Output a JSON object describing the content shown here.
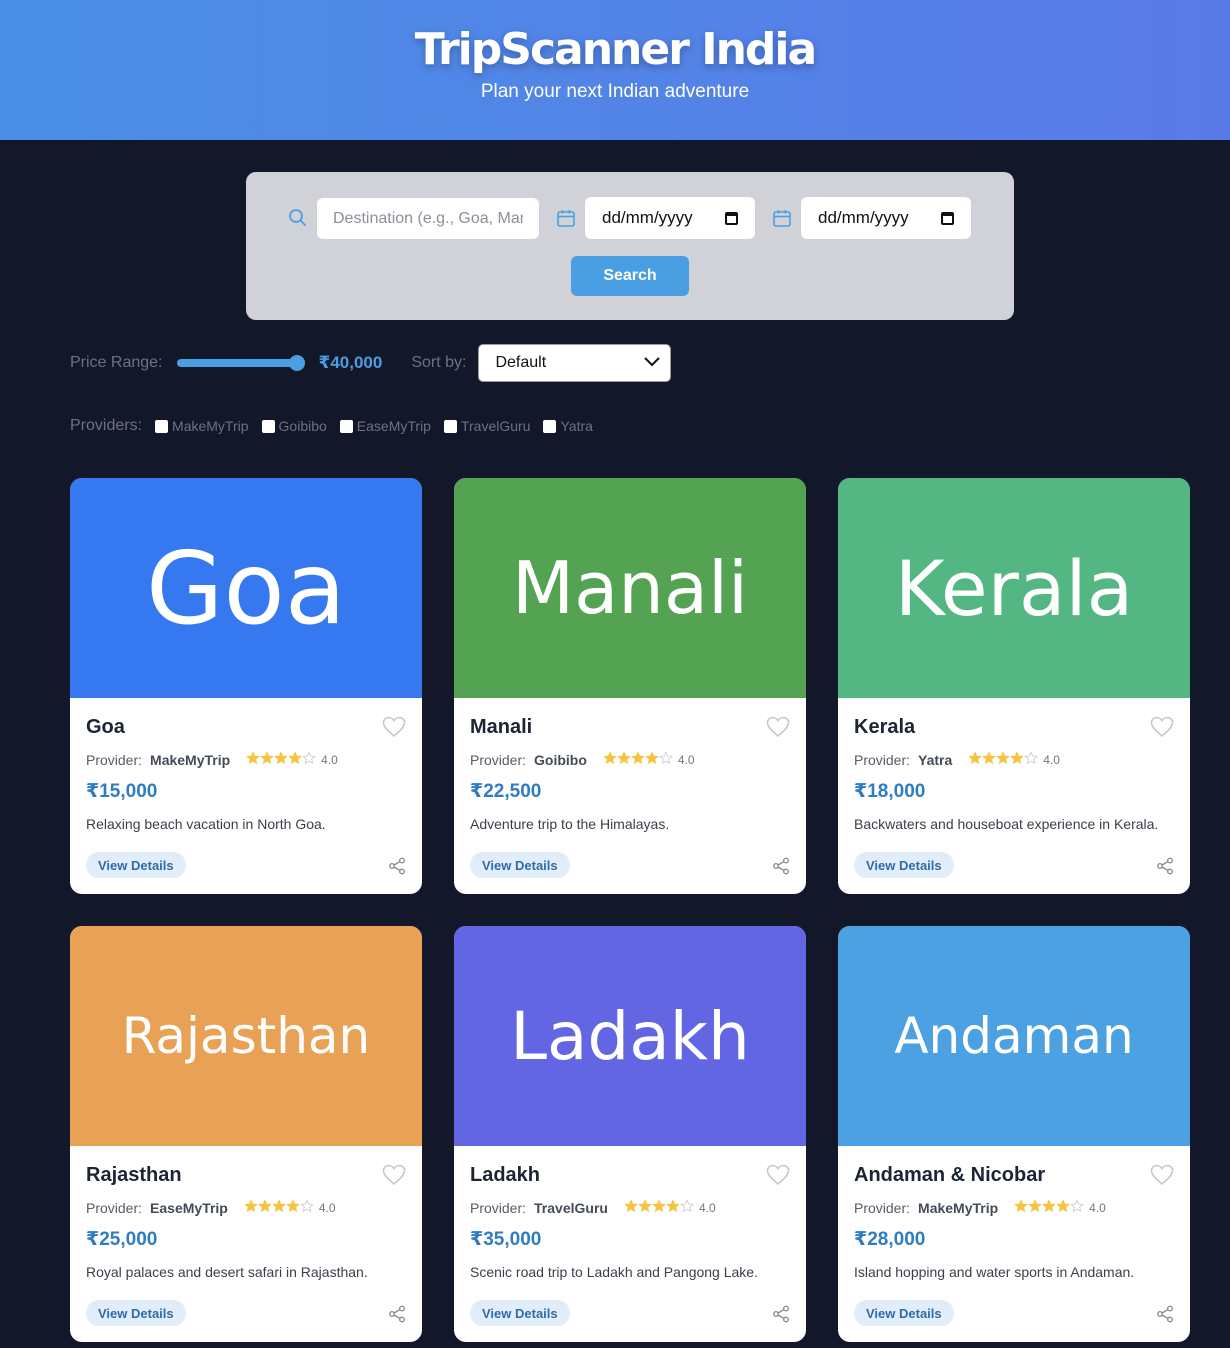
{
  "header": {
    "title": "TripScanner India",
    "subtitle": "Plan your next Indian adventure"
  },
  "search": {
    "destination_placeholder": "Destination (e.g., Goa, Manali)",
    "start_date": "dd/mm/yyyy",
    "end_date": "dd/mm/yyyy",
    "button_label": "Search"
  },
  "filters": {
    "price_label": "Price Range:",
    "price_value": "₹40,000",
    "price_fraction": 1.0,
    "sort_label": "Sort by:",
    "sort_value": "Default",
    "providers_label": "Providers:",
    "providers": [
      {
        "name": "MakeMyTrip",
        "checked": false
      },
      {
        "name": "Goibibo",
        "checked": false
      },
      {
        "name": "EaseMyTrip",
        "checked": false
      },
      {
        "name": "TravelGuru",
        "checked": false
      },
      {
        "name": "Yatra",
        "checked": false
      }
    ]
  },
  "accent_color": "#4a9fe3",
  "cards": [
    {
      "banner_text": "Goa",
      "banner_color": "#3578f0",
      "title": "Goa",
      "provider_label": "Provider:",
      "provider": "MakeMyTrip",
      "stars": 4,
      "rating": "4.0",
      "price": "₹15,000",
      "description": "Relaxing beach vacation in North Goa.",
      "button": "View Details"
    },
    {
      "banner_text": "Manali",
      "banner_color": "#53a353",
      "title": "Manali",
      "provider_label": "Provider:",
      "provider": "Goibibo",
      "stars": 4,
      "rating": "4.0",
      "price": "₹22,500",
      "description": "Adventure trip to the Himalayas.",
      "button": "View Details"
    },
    {
      "banner_text": "Kerala",
      "banner_color": "#54b683",
      "title": "Kerala",
      "provider_label": "Provider:",
      "provider": "Yatra",
      "stars": 4,
      "rating": "4.0",
      "price": "₹18,000",
      "description": "Backwaters and houseboat experience in Kerala.",
      "button": "View Details"
    },
    {
      "banner_text": "Rajasthan",
      "banner_color": "#e9a156",
      "title": "Rajasthan",
      "provider_label": "Provider:",
      "provider": "EaseMyTrip",
      "stars": 4,
      "rating": "4.0",
      "price": "₹25,000",
      "description": "Royal palaces and desert safari in Rajasthan.",
      "button": "View Details"
    },
    {
      "banner_text": "Ladakh",
      "banner_color": "#6366e3",
      "title": "Ladakh",
      "provider_label": "Provider:",
      "provider": "TravelGuru",
      "stars": 4,
      "rating": "4.0",
      "price": "₹35,000",
      "description": "Scenic road trip to Ladakh and Pangong Lake.",
      "button": "View Details"
    },
    {
      "banner_text": "Andaman",
      "banner_color": "#4ba1e1",
      "title": "Andaman & Nicobar",
      "provider_label": "Provider:",
      "provider": "MakeMyTrip",
      "stars": 4,
      "rating": "4.0",
      "price": "₹28,000",
      "description": "Island hopping and water sports in Andaman.",
      "button": "View Details"
    }
  ]
}
